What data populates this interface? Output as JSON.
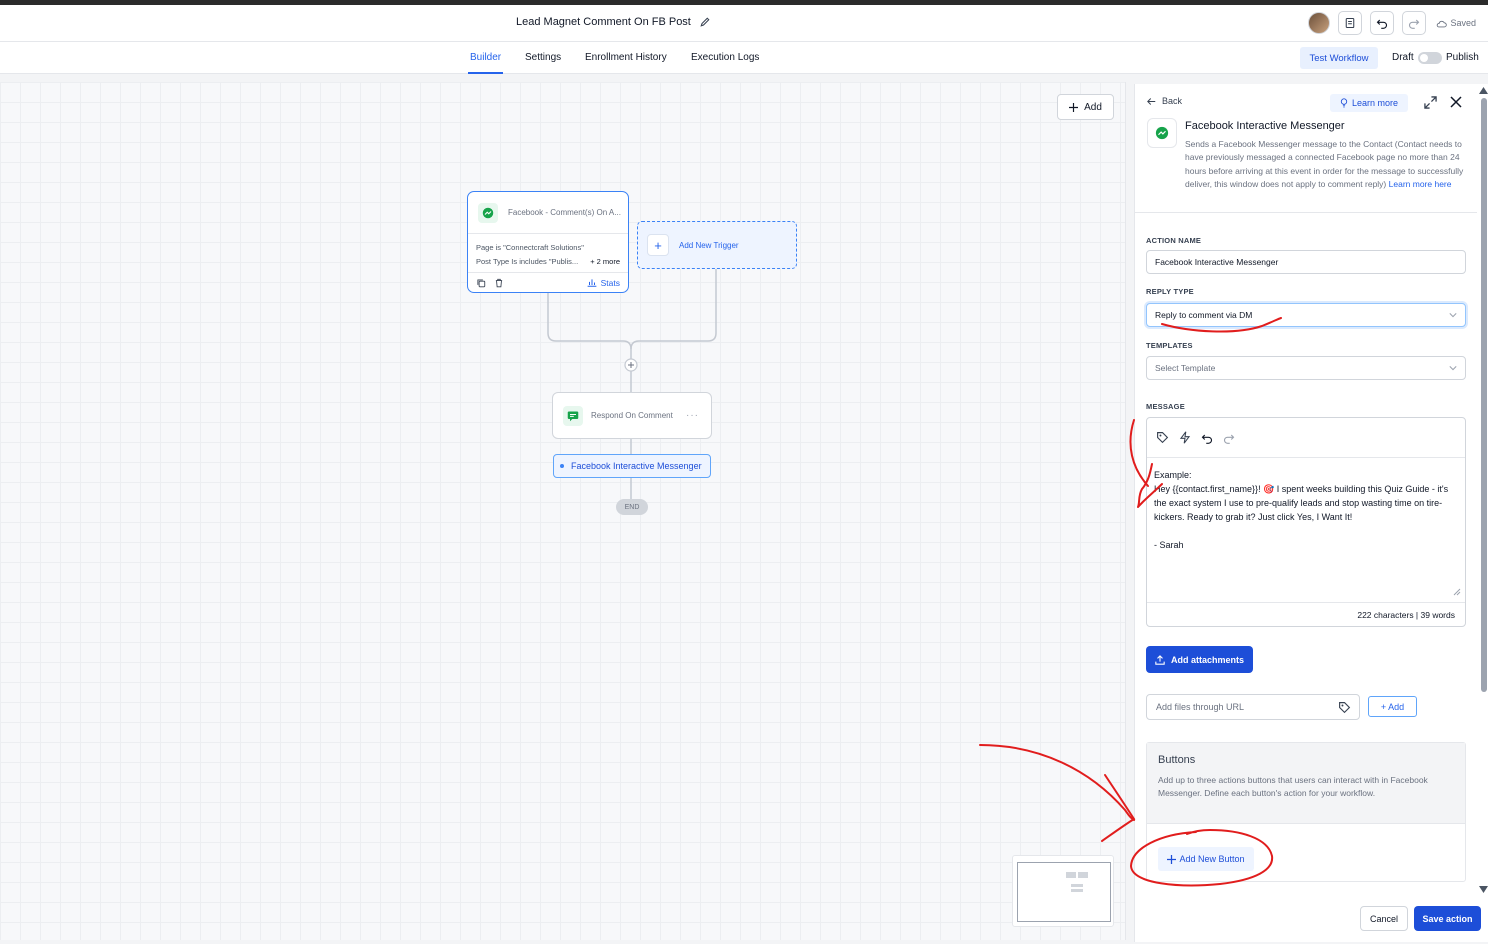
{
  "header": {
    "title": "Lead Magnet Comment On FB Post",
    "saved_label": "Saved"
  },
  "tabs": [
    {
      "label": "Builder",
      "active": true
    },
    {
      "label": "Settings",
      "active": false
    },
    {
      "label": "Enrollment History",
      "active": false
    },
    {
      "label": "Execution Logs",
      "active": false
    }
  ],
  "toolbar": {
    "test_workflow": "Test Workflow",
    "draft": "Draft",
    "publish": "Publish"
  },
  "canvas": {
    "add_label": "Add",
    "trigger": {
      "title": "Facebook - Comment(s) On A...",
      "line1": "Page is \"Connectcraft Solutions\"",
      "line2": "Post Type Is includes \"Publis...",
      "more": "+ 2 more",
      "stats": "Stats"
    },
    "add_trigger": "Add New Trigger",
    "respond": "Respond On Comment",
    "fim": "Facebook Interactive Messenger",
    "end": "END"
  },
  "panel": {
    "back": "Back",
    "learn_more": "Learn more",
    "title": "Facebook Interactive Messenger",
    "description": "Sends a Facebook Messenger message to the Contact (Contact needs to have previously messaged a connected Facebook page no more than 24 hours before arriving at this event in order for the message to successfully deliver, this window does not apply to comment reply)",
    "learn_more_link": "Learn more here",
    "action_name_label": "ACTION NAME",
    "action_name_value": "Facebook Interactive Messenger",
    "reply_type_label": "REPLY TYPE",
    "reply_type_value": "Reply to comment via DM",
    "templates_label": "TEMPLATES",
    "templates_placeholder": "Select Template",
    "message_label": "MESSAGE",
    "message_text": "Example:\nHey {{contact.first_name}}! 🎯 I spent weeks building this Quiz Guide - it's the exact system I use to pre-qualify leads and stop wasting time on tire-kickers. Ready to grab it? Just click Yes, I Want It!\n\n- Sarah",
    "message_count": "222 characters | 39 words",
    "add_attachments": "Add attachments",
    "url_placeholder": "Add files through URL",
    "url_add": "+ Add",
    "buttons_title": "Buttons",
    "buttons_desc": "Add up to three actions buttons that users can interact with in Facebook Messenger. Define each button's action for your workflow.",
    "add_new_button": "Add New Button",
    "cancel": "Cancel",
    "save": "Save action"
  },
  "colors": {
    "primary": "#1d4ed8",
    "accent": "#3b82f6",
    "annotation": "#e11d1d"
  }
}
